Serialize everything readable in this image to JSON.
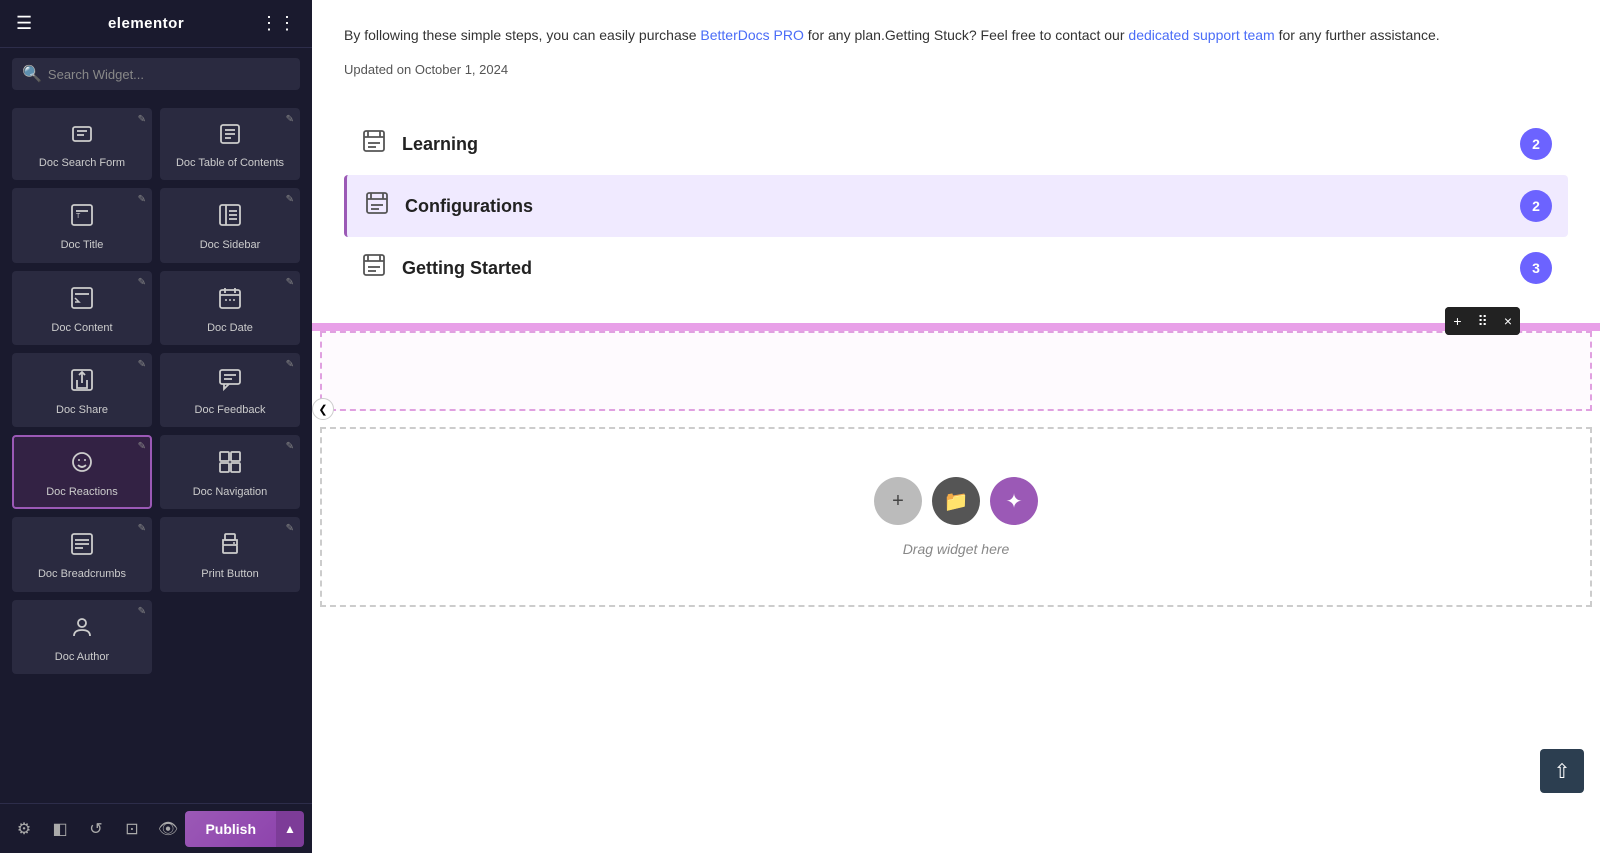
{
  "brand": {
    "name": "elementor"
  },
  "search": {
    "placeholder": "Search Widget..."
  },
  "top_widgets": [
    {
      "id": "doc-search-form",
      "label": "Doc Search Form",
      "icon": "🔍"
    },
    {
      "id": "doc-table-of-contents",
      "label": "Doc Table of Contents",
      "icon": "📋"
    }
  ],
  "widgets": [
    {
      "id": "doc-title",
      "label": "Doc Title",
      "icon": "T",
      "active": false
    },
    {
      "id": "doc-sidebar",
      "label": "Doc Sidebar",
      "icon": "☰",
      "active": false
    },
    {
      "id": "doc-content",
      "label": "Doc Content",
      "icon": "✏️",
      "active": false
    },
    {
      "id": "doc-date",
      "label": "Doc Date",
      "icon": "📅",
      "active": false
    },
    {
      "id": "doc-share",
      "label": "Doc Share",
      "icon": "⬆",
      "active": false
    },
    {
      "id": "doc-feedback",
      "label": "Doc Feedback",
      "icon": "💬",
      "active": false
    },
    {
      "id": "doc-reactions",
      "label": "Doc Reactions",
      "icon": "😊",
      "active": true
    },
    {
      "id": "doc-navigation",
      "label": "Doc Navigation",
      "icon": "⊞",
      "active": false
    },
    {
      "id": "doc-breadcrumbs",
      "label": "Doc Breadcrumbs",
      "icon": "≡",
      "active": false
    },
    {
      "id": "print-button",
      "label": "Print Button",
      "icon": "🖨",
      "active": false
    },
    {
      "id": "doc-author",
      "label": "Doc Author",
      "icon": "👤",
      "active": false
    }
  ],
  "doc": {
    "body_text": "By following these simple steps, you can easily purchase BetterDocs PRO for any plan.Getting Stuck? Feel free to contact our dedicated support team for any further assistance.",
    "updated": "Updated on October 1, 2024",
    "betterdocs_link": "BetterDocs PRO",
    "support_link": "dedicated support team"
  },
  "categories": [
    {
      "id": "learning",
      "label": "Learning",
      "count": 2,
      "active": false
    },
    {
      "id": "configurations",
      "label": "Configurations",
      "count": 2,
      "active": true
    },
    {
      "id": "getting-started",
      "label": "Getting Started",
      "count": 3,
      "active": false
    }
  ],
  "toolbar": {
    "add": "+",
    "move": "⠿",
    "close": "×"
  },
  "drag_section": {
    "label": "Drag widget here"
  },
  "bottom_bar": {
    "publish_label": "Publish",
    "caret": "▲"
  },
  "colors": {
    "accent": "#9b59b6",
    "active_badge": "#6c63ff",
    "panel_bg": "#1a1a2e",
    "pink": "#e8a0e8"
  }
}
